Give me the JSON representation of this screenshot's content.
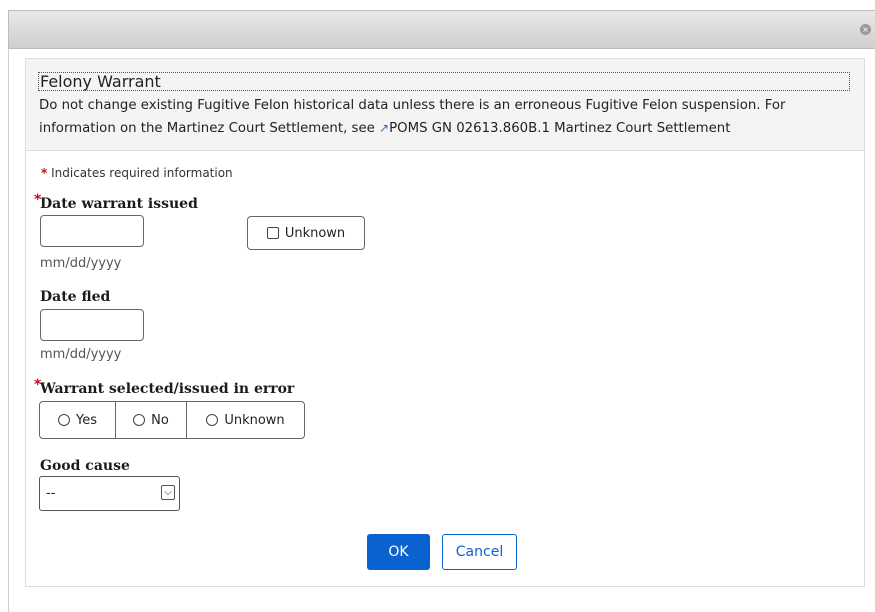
{
  "dialog": {
    "close_icon": "close-icon",
    "close_glyph": "×"
  },
  "header": {
    "title": "Felony Warrant",
    "text_before_link": "Do not change existing Fugitive Felon historical data unless there is an erroneous Fugitive Felon suspension. For information on the Martinez Court Settlement, see ",
    "link_icon": "external-link-icon",
    "link_text": "POMS GN 02613.860B.1 Martinez Court Settlement"
  },
  "form": {
    "required_marker": "*",
    "required_note": "Indicates required information",
    "date_issued": {
      "label": "Date warrant issued",
      "value": "",
      "hint": "mm/dd/yyyy",
      "unknown_label": "Unknown",
      "unknown_checked": false
    },
    "date_fled": {
      "label": "Date fled",
      "value": "",
      "hint": "mm/dd/yyyy"
    },
    "warrant_error": {
      "label": "Warrant selected/issued in error",
      "options": [
        "Yes",
        "No",
        "Unknown"
      ],
      "selected": null
    },
    "good_cause": {
      "label": "Good cause",
      "selected": "--"
    }
  },
  "buttons": {
    "ok": "OK",
    "cancel": "Cancel"
  },
  "colors": {
    "primary": "#0a62d0",
    "required": "#d0021b",
    "header_bg": "#f4f4f4"
  }
}
